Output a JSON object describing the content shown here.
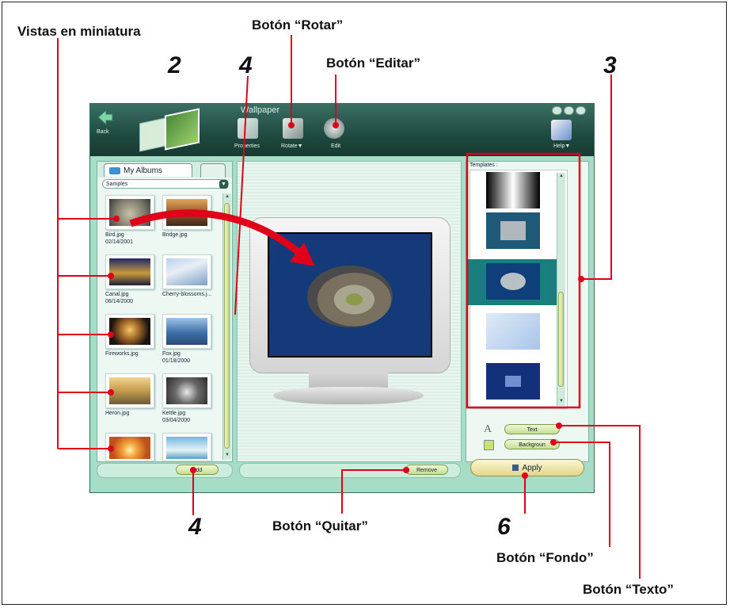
{
  "callouts": {
    "thumbnails": "Vistas en miniatura",
    "rotate_button": "Botón “Rotar”",
    "edit_button": "Botón “Editar”",
    "remove_button": "Botón “Quitar”",
    "background_button": "Botón “Fondo”",
    "text_button": "Botón “Texto”"
  },
  "step_numbers": [
    "2",
    "4",
    "3",
    "4",
    "6"
  ],
  "window": {
    "title": "Wallpaper",
    "back_label": "Back",
    "toolbar": {
      "properties": "Properties",
      "rotate": "Rotate▼",
      "edit": "Edit",
      "help": "Help▼"
    }
  },
  "left_pane": {
    "tab_label": "My Albums",
    "album_select": "Samples",
    "thumbnails": [
      {
        "name": "Bird.jpg",
        "date": "02/14/2001"
      },
      {
        "name": "Bridge.jpg",
        "date": ""
      },
      {
        "name": "Canal.jpg",
        "date": "06/14/2000"
      },
      {
        "name": "Cherry-blossoms.j...",
        "date": ""
      },
      {
        "name": "Fireworks.jpg",
        "date": ""
      },
      {
        "name": "Fox.jpg",
        "date": "01/18/2000"
      },
      {
        "name": "Heron.jpg",
        "date": ""
      },
      {
        "name": "Kettle.jpg",
        "date": "03/04/2000"
      }
    ],
    "add_button": "Add"
  },
  "center": {
    "remove_button": "Remove"
  },
  "right_pane": {
    "templates_label": "Templates :",
    "text_button": "Text",
    "background_button": "Backgroun",
    "apply_button": "Apply"
  },
  "colors": {
    "callout_red": "#e0001a",
    "title_bar": "#1f4a40",
    "window_bg": "#a7dcc6",
    "selected_template": "#1a7d7e"
  }
}
